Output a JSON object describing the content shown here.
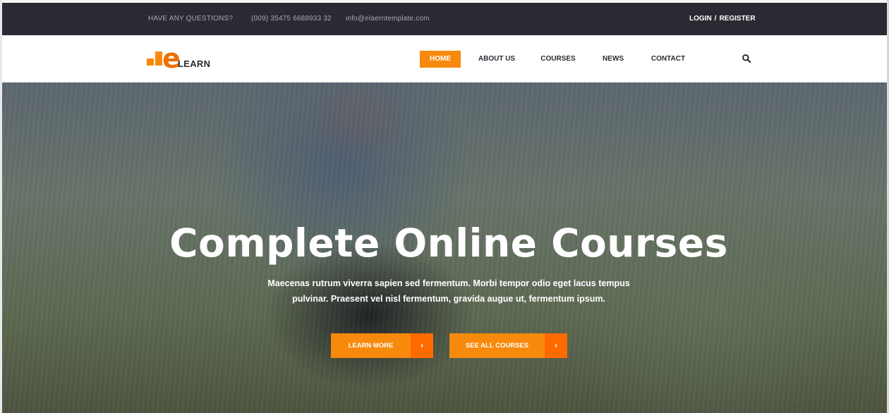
{
  "topbar": {
    "question": "HAVE ANY QUESTIONS?",
    "phone": "(009) 35475 6688933 32",
    "email": "info@elaerntemplate.com",
    "login": "LOGIN",
    "separator": "/",
    "register": "REGISTER"
  },
  "logo": {
    "letter": "e",
    "text": "LEARN"
  },
  "nav": [
    {
      "label": "HOME",
      "active": true
    },
    {
      "label": "ABOUT US"
    },
    {
      "label": "COURSES"
    },
    {
      "label": "NEWS"
    },
    {
      "label": "CONTACT"
    }
  ],
  "search": {
    "icon": "search-icon"
  },
  "hero": {
    "title": "Complete Online Courses",
    "subtitle_line1": "Maecenas rutrum viverra sapien sed fermentum. Morbi tempor odio eget lacus tempus",
    "subtitle_line2": "pulvinar. Praesent vel nisl fermentum, gravida augue ut, fermentum ipsum.",
    "buttons": [
      {
        "label": "LEARN MORE",
        "icon": "chevron-right-icon"
      },
      {
        "label": "SEE ALL COURSES",
        "icon": "chevron-right-icon"
      }
    ]
  },
  "colors": {
    "accent": "#f78a0d",
    "accent_dark": "#ff6a00",
    "topbar_bg": "#2b2a33"
  }
}
